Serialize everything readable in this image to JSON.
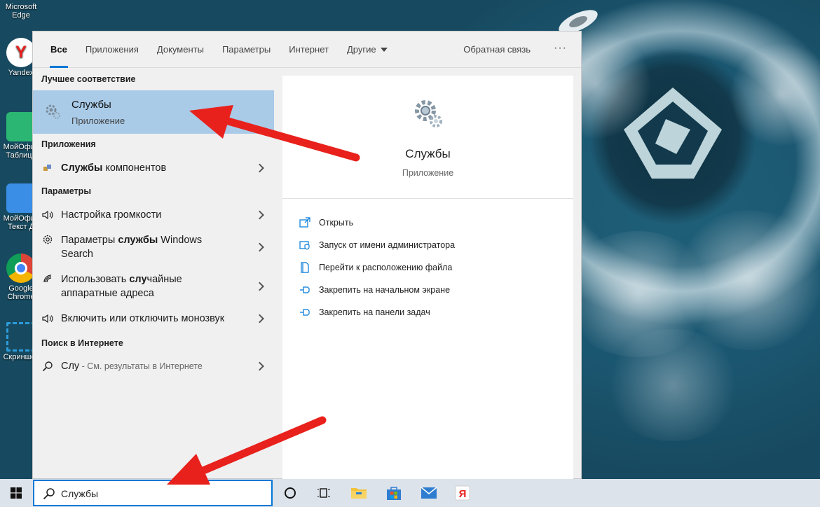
{
  "desktop": {
    "icons": [
      {
        "label": "Microsoft Edge",
        "line1": "Microsoft",
        "line2": "Edge",
        "icon": "edge-icon"
      },
      {
        "label": "Yandex",
        "line1": "Yandex",
        "icon": "yandex-browser-icon"
      },
      {
        "label": "МойОфис Таблица",
        "line1": "МойОфис",
        "line2": "Таблица",
        "icon": "myoffice-table-icon"
      },
      {
        "label": "МойОфис Текст",
        "line1": "МойОфис",
        "line2": "Текст Д",
        "icon": "myoffice-text-icon"
      },
      {
        "label": "Google Chrome",
        "line1": "Google",
        "line2": "Chrome",
        "icon": "chrome-icon"
      },
      {
        "label": "Скриншот",
        "line1": "Скриншот",
        "icon": "screenshot-icon"
      }
    ]
  },
  "search_panel": {
    "tabs": [
      "Все",
      "Приложения",
      "Документы",
      "Параметры",
      "Интернет",
      "Другие"
    ],
    "feedback": "Обратная связь",
    "more": "···",
    "best_match": {
      "section": "Лучшее соответствие",
      "title": "Службы",
      "subtitle": "Приложение"
    },
    "apps": {
      "section": "Приложения",
      "items": [
        {
          "pre": "",
          "bold": "Службы",
          "post": " компонентов",
          "icon": "component-services-icon"
        }
      ]
    },
    "settings": {
      "section": "Параметры",
      "items": [
        {
          "text": "Настройка громкости",
          "icon": "speaker-icon"
        },
        {
          "line1_pre": "Параметры ",
          "line1_bold": "службы",
          "line1_post": " Windows",
          "line2": "Search",
          "icon": "gear-icon"
        },
        {
          "line1_pre": "Использовать ",
          "line1_bold": "слу",
          "line1_post": "чайные",
          "line2": "аппаратные адреса",
          "icon": "wifi-icon"
        },
        {
          "text": "Включить или отключить монозвук",
          "icon": "speaker-icon"
        }
      ]
    },
    "web": {
      "section": "Поиск в Интернете",
      "query": "Слу",
      "hint": " - См. результаты в Интернете"
    },
    "preview": {
      "name": "Службы",
      "kind": "Приложение",
      "actions": [
        {
          "label": "Открыть",
          "icon": "open-icon"
        },
        {
          "label": "Запуск от имени администратора",
          "icon": "admin-shield-icon"
        },
        {
          "label": "Перейти к расположению файла",
          "icon": "file-location-icon"
        },
        {
          "label": "Закрепить на начальном экране",
          "icon": "pin-icon"
        },
        {
          "label": "Закрепить на панели задач",
          "icon": "pin-icon"
        }
      ]
    }
  },
  "taskbar": {
    "search_value": "Службы",
    "icons": [
      "windows-start-icon",
      "cortana-icon",
      "task-view-icon",
      "file-explorer-icon",
      "store-icon",
      "mail-icon",
      "yandex-icon"
    ]
  },
  "colors": {
    "accent": "#0078d7",
    "best_match_bg": "#a9cbe8",
    "arrow": "#e8211c"
  }
}
